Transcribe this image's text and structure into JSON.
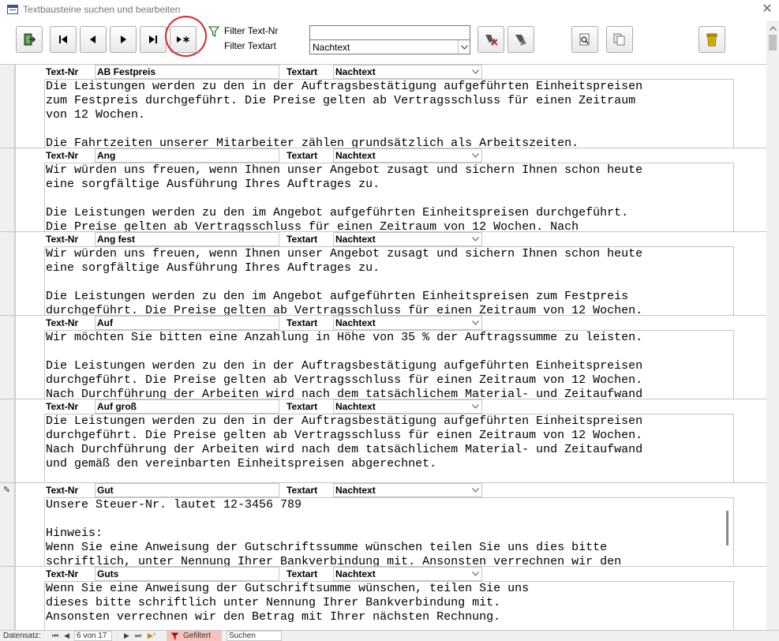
{
  "window": {
    "title": "Textbausteine suchen und bearbeiten",
    "close_glyph": "✕"
  },
  "toolbar": {
    "buttons": [
      {
        "name": "exit-icon"
      },
      {
        "name": "first-record-icon"
      },
      {
        "name": "previous-record-icon"
      },
      {
        "name": "next-record-icon"
      },
      {
        "name": "last-record-icon"
      },
      {
        "name": "new-record-icon"
      },
      {
        "name": "filter-clear-icon"
      },
      {
        "name": "filter-apply-icon"
      },
      {
        "name": "print-preview-icon"
      },
      {
        "name": "copy-icon"
      },
      {
        "name": "delete-icon"
      }
    ],
    "highlight_color": "#e0242a"
  },
  "filter": {
    "nr_label": "Filter Text-Nr",
    "art_label": "Filter Textart",
    "nr_value": "",
    "art_value": "Nachtext"
  },
  "records": [
    {
      "nr_label": "Text-Nr",
      "nr": "AB Festpreis",
      "art_label": "Textart",
      "art": "Nachtext",
      "text": "Die Leistungen werden zu den in der Auftragsbestätigung aufgeführten Einheitspreisen\nzum Festpreis durchgeführt. Die Preise gelten ab Vertragsschluss für einen Zeitraum\nvon 12 Wochen.\n\nDie Fahrtzeiten unserer Mitarbeiter zählen grundsätzlich als Arbeitszeiten."
    },
    {
      "nr_label": "Text-Nr",
      "nr": "Ang",
      "art_label": "Textart",
      "art": "Nachtext",
      "text": "Wir würden uns freuen, wenn Ihnen unser Angebot zusagt und sichern Ihnen schon heute\neine sorgfältige Ausführung Ihres Auftrages zu.\n\nDie Leistungen werden zu den im Angebot aufgeführten Einheitspreisen durchgeführt.\nDie Preise gelten ab Vertragsschluss für einen Zeitraum von 12 Wochen. Nach"
    },
    {
      "nr_label": "Text-Nr",
      "nr": "Ang fest",
      "art_label": "Textart",
      "art": "Nachtext",
      "text": "Wir würden uns freuen, wenn Ihnen unser Angebot zusagt und sichern Ihnen schon heute\neine sorgfältige Ausführung Ihres Auftrages zu.\n\nDie Leistungen werden zu den im Angebot aufgeführten Einheitspreisen zum Festpreis\ndurchgeführt. Die Preise gelten ab Vertragsschluss für einen Zeitraum von 12 Wochen."
    },
    {
      "nr_label": "Text-Nr",
      "nr": "Auf",
      "art_label": "Textart",
      "art": "Nachtext",
      "text": "Wir möchten Sie bitten eine Anzahlung in Höhe von 35 % der Auftragssumme zu leisten.\n\nDie Leistungen werden zu den in der Auftragsbestätigung aufgeführten Einheitspreisen\ndurchgeführt. Die Preise gelten ab Vertragsschluss für einen Zeitraum von 12 Wochen.\nNach Durchführung der Arbeiten wird nach dem tatsächlichem Material- und Zeitaufwand"
    },
    {
      "nr_label": "Text-Nr",
      "nr": "Auf groß",
      "art_label": "Textart",
      "art": "Nachtext",
      "text": "Die Leistungen werden zu den in der Auftragsbestätigung aufgeführten Einheitspreisen\ndurchgeführt. Die Preise gelten ab Vertragsschluss für einen Zeitraum von 12 Wochen.\nNach Durchführung der Arbeiten wird nach dem tatsächlichem Material- und Zeitaufwand\nund gemäß den vereinbarten Einheitspreisen abgerechnet."
    },
    {
      "nr_label": "Text-Nr",
      "nr": "Gut",
      "art_label": "Textart",
      "art": "Nachtext",
      "text": "Unsere Steuer-Nr. lautet 12-3456 789\n\nHinweis:\nWenn Sie eine Anweisung der Gutschriftssumme wünschen teilen Sie uns dies bitte\nschriftlich, unter Nennung Ihrer Bankverbindung mit. Ansonsten verrechnen wir den"
    },
    {
      "nr_label": "Text-Nr",
      "nr": "Guts",
      "art_label": "Textart",
      "art": "Nachtext",
      "text": "Wenn Sie eine Anweisung der Gutschriftsumme wünschen, teilen Sie uns\ndieses bitte schriftlich unter Nennung Ihrer Bankverbindung mit.\nAnsonsten verrechnen wir den Betrag mit Ihrer nächsten Rechnung."
    }
  ],
  "statusbar": {
    "label": "Datensatz:",
    "nav_first": "⏮",
    "nav_prev": "◀",
    "current": "6 von 17",
    "nav_next": "▶",
    "nav_last": "⏭",
    "nav_new": "▶*",
    "filter_label": "Gefiltert",
    "search_label": "Suchen",
    "filter_color": "#f5c2be"
  }
}
